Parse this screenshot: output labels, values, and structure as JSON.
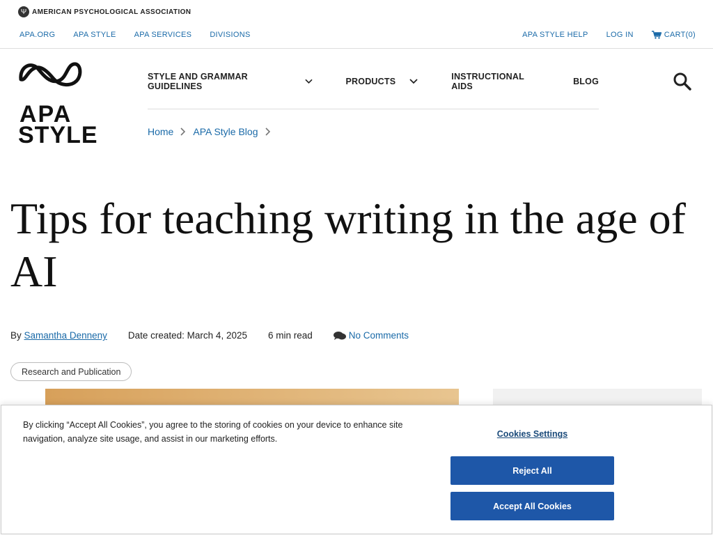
{
  "brand": {
    "org_name": "AMERICAN PSYCHOLOGICAL ASSOCIATION",
    "logo_line1": "APA",
    "logo_line2": "STYLE"
  },
  "top_links": [
    "APA.ORG",
    "APA STYLE",
    "APA SERVICES",
    "DIVISIONS"
  ],
  "right_links": {
    "help": "APA STYLE HELP",
    "login": "LOG IN",
    "cart": "CART(0)"
  },
  "main_nav": [
    {
      "label": "STYLE AND GRAMMAR GUIDELINES",
      "has_dropdown": true
    },
    {
      "label": "PRODUCTS",
      "has_dropdown": true
    },
    {
      "label": "INSTRUCTIONAL AIDS",
      "has_dropdown": false
    },
    {
      "label": "BLOG",
      "has_dropdown": false
    }
  ],
  "breadcrumb": [
    "Home",
    "APA Style Blog"
  ],
  "article": {
    "title": "Tips for teaching writing in the age of AI",
    "by_label": "By",
    "author": "Samantha Denneny",
    "date": "Date created: March 4, 2025",
    "read_time": "6 min read",
    "comments": "No Comments",
    "tag": "Research and Publication"
  },
  "cookie": {
    "message": "By clicking “Accept All Cookies”, you agree to the storing of cookies on your device to enhance site navigation, analyze site usage, and assist in our marketing efforts.",
    "settings_label": "Cookies Settings",
    "reject_label": "Reject All",
    "accept_label": "Accept All Cookies"
  },
  "colors": {
    "link": "#1a6aa8",
    "button": "#1e57a8"
  }
}
